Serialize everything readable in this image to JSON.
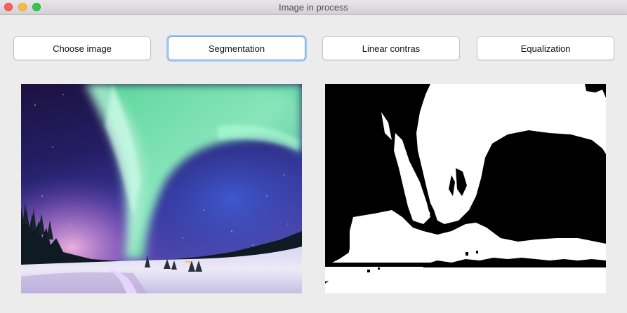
{
  "window": {
    "title": "Image in process"
  },
  "toolbar": {
    "buttons": [
      {
        "label": "Choose image"
      },
      {
        "label": "Segmentation",
        "focused": true
      },
      {
        "label": "Linear contras"
      },
      {
        "label": "Equalization"
      }
    ]
  },
  "panels": {
    "original": {
      "icon": "aurora-photo"
    },
    "processed": {
      "icon": "segmented-binary-image"
    }
  },
  "colors": {
    "window_bg": "#ececec",
    "focus_ring": "#6aa3e6",
    "close": "#fc605c",
    "minimize": "#fdbc40",
    "maximize": "#34c84a"
  }
}
